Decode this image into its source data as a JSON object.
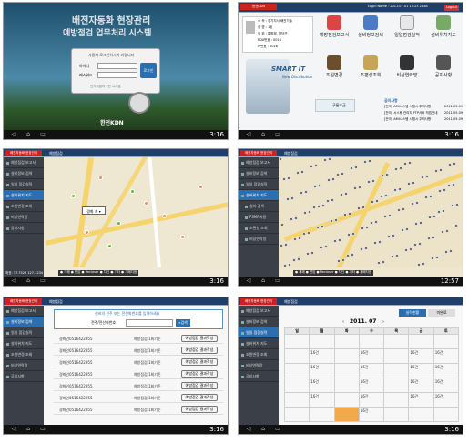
{
  "statusbar": {
    "time_1": "3:16",
    "time_2": "3:16",
    "time_3": "3:16",
    "time_4": "12:57",
    "time_5": "3:16",
    "time_6": "3:16"
  },
  "login": {
    "title_line1": "배전자동화 현장관리",
    "title_line2": "예방점검 업무처리 시스템",
    "box_title": "사용자 로그인하시기 바랍니다",
    "id_label": "아이디",
    "pw_label": "패스워드",
    "login_button": "로그인",
    "footer": "전기사업자 1번 시스템",
    "logo": "한전KDN"
  },
  "home": {
    "header": "Login Name : 2011.07.01 13:23 2848",
    "logout": "Logout",
    "user_fields": [
      "소  속 : 경기지사 배전기술",
      "성  명 : 1호",
      "직  위 : 통합제, 담당관",
      "PDA번호 : 0016",
      "IP번호 : 0016"
    ],
    "menu": [
      {
        "label": "예방점검보고서"
      },
      {
        "label": "설비정보검색"
      },
      {
        "label": "일일점검실적"
      },
      {
        "label": "설비위치지도"
      },
      {
        "label": "조원변경"
      },
      {
        "label": "조편성조회"
      },
      {
        "label": "비상연락망"
      },
      {
        "label": "공지사항"
      }
    ],
    "brand_main": "SMART IT",
    "brand_sub": "New Distribution",
    "weather": "구름조금",
    "notice_title": "공지사항",
    "notices": [
      {
        "text": "[전국] AMI시스템 시험시 주의사항",
        "date": "2011.05.09"
      },
      {
        "text": "[전국] 시스템 관리자 FTP서버 작업안내",
        "date": "2011.05.09"
      },
      {
        "text": "[전국] AMI시스템 시험시 주의사항",
        "date": "2011.05.09"
      }
    ]
  },
  "sidebar": {
    "logo": "배전자동화 현장관리",
    "items": [
      "예방점검 보고서",
      "설비정보 검색",
      "일일 점검실적",
      "설비위치 지도",
      "조원변경 조회",
      "비상연락망",
      "공지사항"
    ],
    "sub": [
      "설비 검색",
      "FSMR사용",
      "조편성 조회",
      "비상연락망"
    ]
  },
  "map": {
    "tab": "예방점검",
    "popup": "경화 지 ▾",
    "legend": "● 개폐  ● 변압  ● Recloser  ● 차단  ● 기타  ● 개폐지점",
    "coords": "좌표: 37.7523 127.1234"
  },
  "search": {
    "tab": "예방점검",
    "prompt": "설비의 전주 또는 전산화번호를 입력하세요",
    "field_label": "전주/전산화번호",
    "button": "검색",
    "rows": [
      {
        "num": "경화인0516422955",
        "addr": "동성안진수_강련도 동산암지도(로HT",
        "type": "예방점검 1회기준",
        "btn": "예방점검 결과작성"
      },
      {
        "num": "경화인0516422955",
        "addr": "동성안진수_강련도 동산암지도(로HT",
        "type": "예방점검 1회기준",
        "btn": "예방점검 결과작성"
      },
      {
        "num": "경화인0516422955",
        "addr": "동성안진수_강련도 동산암지도(로HT",
        "type": "예방점검 1회기준",
        "btn": "예방점검 결과작성"
      },
      {
        "num": "경화인0516422955",
        "addr": "동성안진수_강련도 동산암지도(로HT",
        "type": "예방점검 1회기준",
        "btn": "예방점검 결과작성"
      },
      {
        "num": "경화인0516422955",
        "addr": "동성안진수_강련도 동산암지도(로HT",
        "type": "예방점검 1회기준",
        "btn": "예방점검 결과작성"
      },
      {
        "num": "경화인0516422955",
        "addr": "동성안진수_강련도 동산암지도(로HT",
        "type": "예방점검 1회기준",
        "btn": "예방점검 결과작성"
      },
      {
        "num": "경화인0516422955",
        "addr": "동성안진수_강련도 동산암지도(로HT",
        "type": "예방점검 1회기준",
        "btn": "예방점검 결과작성"
      }
    ]
  },
  "calendar": {
    "tab": "예방점검",
    "month": "2011. 07",
    "tab_a": "실적현황",
    "tab_b": "미완료",
    "days": [
      "일",
      "월",
      "화",
      "수",
      "목",
      "금",
      "토"
    ],
    "cell": "16건"
  }
}
